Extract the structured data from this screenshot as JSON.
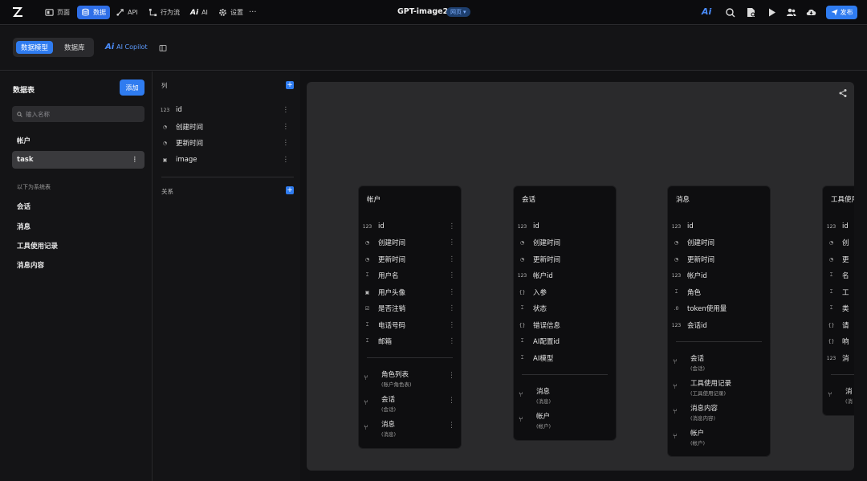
{
  "topbar": {
    "nav": [
      {
        "label": "页面",
        "icon": "page-icon"
      },
      {
        "label": "数据",
        "icon": "database-icon"
      },
      {
        "label": "API",
        "icon": "api-icon"
      },
      {
        "label": "行为流",
        "icon": "flow-icon"
      },
      {
        "label": "AI",
        "icon": "ai-icon"
      },
      {
        "label": "设置",
        "icon": "gear-icon"
      }
    ],
    "more": "···",
    "title": "GPT-image2",
    "badge": "网页",
    "publish": "发布"
  },
  "subbar": {
    "tabs": [
      "数据模型",
      "数据库"
    ],
    "copilot": "AI Copilot"
  },
  "sidebar": {
    "title": "数据表",
    "add": "添加",
    "search_placeholder": "输入名称",
    "user_tables": [
      "帐户",
      "task"
    ],
    "system_note": "以下为系统表",
    "system_tables": [
      "会话",
      "消息",
      "工具使用记录",
      "消息内容"
    ]
  },
  "columns_panel": {
    "columns_header": "列",
    "columns": [
      {
        "name": "id",
        "icon": "number-icon"
      },
      {
        "name": "创建时间",
        "icon": "clock-icon"
      },
      {
        "name": "更新时间",
        "icon": "clock-icon"
      },
      {
        "name": "image",
        "icon": "image-icon"
      }
    ],
    "relations_header": "关系"
  },
  "canvas": {
    "cards": [
      {
        "title": "帐户",
        "fields": [
          {
            "name": "id",
            "icon": "number-icon"
          },
          {
            "name": "创建时间",
            "icon": "clock-icon"
          },
          {
            "name": "更新时间",
            "icon": "clock-icon"
          },
          {
            "name": "用户名",
            "icon": "text-icon"
          },
          {
            "name": "用户头像",
            "icon": "image-icon"
          },
          {
            "name": "是否注销",
            "icon": "checkbox-icon"
          },
          {
            "name": "电话号码",
            "icon": "text-icon"
          },
          {
            "name": "邮箱",
            "icon": "text-icon"
          }
        ],
        "relations": [
          {
            "name": "角色列表",
            "sub": "(账户角色表)"
          },
          {
            "name": "会话",
            "sub": "(会话)"
          },
          {
            "name": "消息",
            "sub": "(消息)"
          }
        ]
      },
      {
        "title": "会话",
        "fields": [
          {
            "name": "id",
            "icon": "number-icon"
          },
          {
            "name": "创建时间",
            "icon": "clock-icon"
          },
          {
            "name": "更新时间",
            "icon": "clock-icon"
          },
          {
            "name": "帐户id",
            "icon": "number-icon"
          },
          {
            "name": "入参",
            "icon": "json-icon"
          },
          {
            "name": "状态",
            "icon": "text-icon"
          },
          {
            "name": "错误信息",
            "icon": "json-icon"
          },
          {
            "name": "AI配置id",
            "icon": "text-icon"
          },
          {
            "name": "AI模型",
            "icon": "text-icon"
          }
        ],
        "relations": [
          {
            "name": "消息",
            "sub": "(消息)"
          },
          {
            "name": "帐户",
            "sub": "(帐户)"
          }
        ]
      },
      {
        "title": "消息",
        "fields": [
          {
            "name": "id",
            "icon": "number-icon"
          },
          {
            "name": "创建时间",
            "icon": "clock-icon"
          },
          {
            "name": "更新时间",
            "icon": "clock-icon"
          },
          {
            "name": "帐户id",
            "icon": "number-icon"
          },
          {
            "name": "角色",
            "icon": "text-icon"
          },
          {
            "name": "token使用量",
            "icon": "decimal-icon"
          },
          {
            "name": "会话id",
            "icon": "number-icon"
          }
        ],
        "relations": [
          {
            "name": "会话",
            "sub": "(会话)"
          },
          {
            "name": "工具使用记录",
            "sub": "(工具使用记录)"
          },
          {
            "name": "消息内容",
            "sub": "(消息内容)"
          },
          {
            "name": "帐户",
            "sub": "(帐户)"
          }
        ]
      },
      {
        "title": "工具使用",
        "fields": [
          {
            "name": "id",
            "icon": "number-icon"
          },
          {
            "name": "创",
            "icon": "clock-icon"
          },
          {
            "name": "更",
            "icon": "clock-icon"
          },
          {
            "name": "名",
            "icon": "text-icon"
          },
          {
            "name": "工",
            "icon": "text-icon"
          },
          {
            "name": "类",
            "icon": "text-icon"
          },
          {
            "name": "请",
            "icon": "json-icon"
          },
          {
            "name": "响",
            "icon": "json-icon"
          },
          {
            "name": "消",
            "icon": "number-icon"
          }
        ],
        "relations": [
          {
            "name": "消",
            "sub": "(消"
          }
        ]
      }
    ]
  }
}
